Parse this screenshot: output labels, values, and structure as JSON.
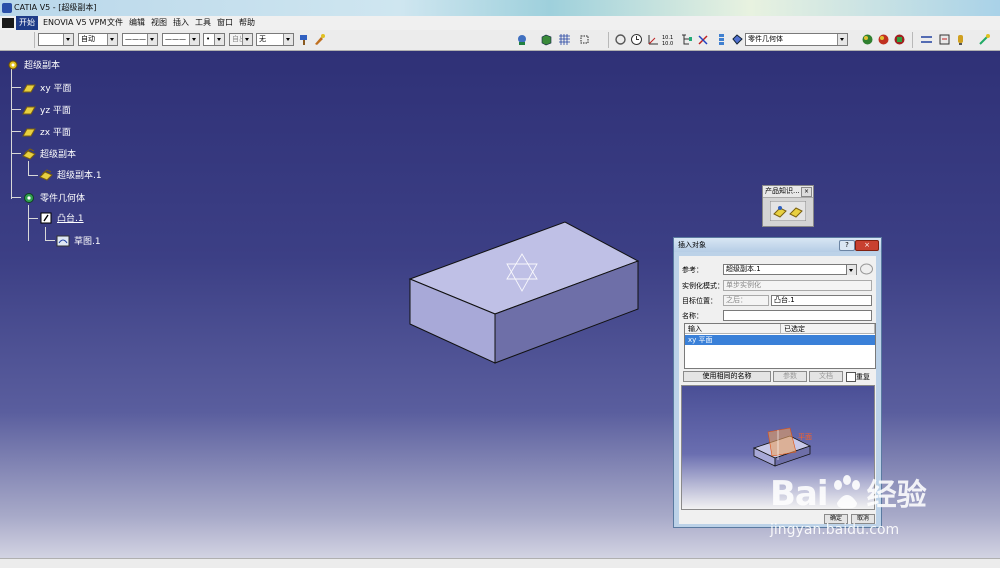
{
  "window": {
    "title": "CATIA V5 - [超级副本]"
  },
  "menu": [
    "开始",
    "ENOVIA V5 VPM",
    "文件",
    "编辑",
    "视图",
    "插入",
    "工具",
    "窗口",
    "帮助"
  ],
  "toolbar": {
    "combo_color": "",
    "combo_auto": "自动",
    "combo_line1": "———",
    "combo_line2": "———",
    "combo_dot": "•",
    "combo_layer": "自出",
    "combo_none": "无",
    "combo_workbench": "零件几何体"
  },
  "tree": {
    "root": "超级副本",
    "items": [
      "xy 平面",
      "yz 平面",
      "zx 平面",
      "超级副本",
      "超级副本.1",
      "零件几何体",
      "凸台.1",
      "草图.1"
    ]
  },
  "product_knowledge": {
    "title": "产品知识..."
  },
  "dialog": {
    "title": "插入对象",
    "ref_label": "参考：",
    "ref_value": "超级副本.1",
    "mode_label": "实例化模式：",
    "mode_value": "单步实例化",
    "target_label": "目标位置：",
    "target_after": "之后：",
    "target_value": "凸台.1",
    "name_label": "名称：",
    "name_value": "",
    "col_input": "输入",
    "col_selected": "已选定",
    "row_input": "xy 平面",
    "row_selected": "",
    "btn_same_name": "使用相同的名称",
    "btn_params": "参数",
    "btn_doc": "文档",
    "repeat_label": "重复",
    "preview_label": "平面",
    "btn_ok": "确定",
    "btn_cancel": "取消"
  },
  "watermark": {
    "brand": "Bai",
    "brand2": "经验",
    "url": "jingyan.baidu.com"
  }
}
